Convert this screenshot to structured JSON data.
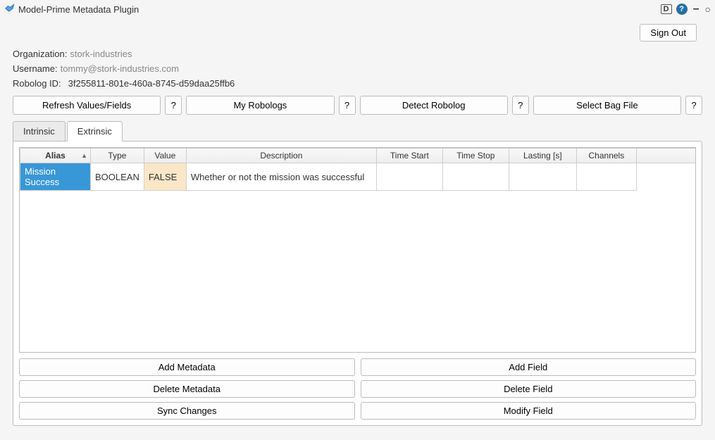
{
  "title": "Model-Prime Metadata Plugin",
  "titlebar_right": {
    "d_badge": "D"
  },
  "signout_btn": "Sign Out",
  "info": {
    "org_label": "Organization:",
    "org_value": "stork-industries",
    "user_label": "Username:",
    "user_value": "tommy@stork-industries.com",
    "robolog_label": "Robolog ID:",
    "robolog_value": "3f255811-801e-460a-8745-d59daa25ffb6"
  },
  "top_buttons": {
    "refresh": "Refresh Values/Fields",
    "my_robologs": "My Robologs",
    "detect": "Detect Robolog",
    "select_bag": "Select Bag File",
    "help": "?"
  },
  "tabs": {
    "intrinsic": "Intrinsic",
    "extrinsic": "Extrinsic"
  },
  "table": {
    "headers": {
      "alias": "Alias",
      "type": "Type",
      "value": "Value",
      "description": "Description",
      "time_start": "Time Start",
      "time_stop": "Time Stop",
      "lasting": "Lasting [s]",
      "channels": "Channels"
    },
    "rows": [
      {
        "alias": "Mission Success",
        "type": "BOOLEAN",
        "value": "FALSE",
        "description": "Whether or not the mission was successful",
        "time_start": "",
        "time_stop": "",
        "lasting": "",
        "channels": ""
      }
    ]
  },
  "bottom_buttons": {
    "add_metadata": "Add Metadata",
    "delete_metadata": "Delete Metadata",
    "sync_changes": "Sync Changes",
    "add_field": "Add Field",
    "delete_field": "Delete Field",
    "modify_field": "Modify Field"
  }
}
